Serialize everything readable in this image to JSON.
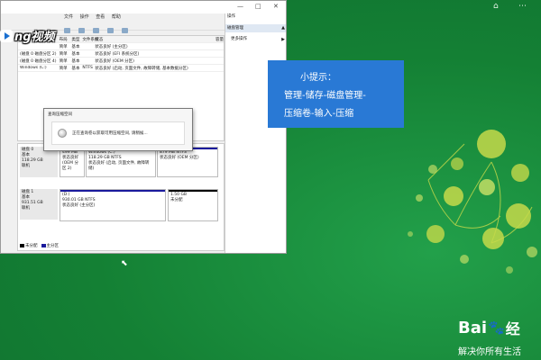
{
  "video_logo": {
    "text": "ng视频"
  },
  "window": {
    "controls": {
      "minimize": "—",
      "maximize": "□",
      "close": "✕"
    },
    "menu": [
      "文件",
      "操作",
      "查看",
      "帮助"
    ],
    "volume_table": {
      "headers": {
        "name": "卷",
        "layout": "布局",
        "type": "类型",
        "fs": "文件系统",
        "status": "状态",
        "capacity": "容量"
      },
      "rows": [
        {
          "name": "",
          "layout": "简单",
          "type": "基本",
          "fs": "",
          "status": "状态良好 (主分区)",
          "capacity": ""
        },
        {
          "name": "(磁盘 0 磁盘分区 2)",
          "layout": "简单",
          "type": "基本",
          "fs": "",
          "status": "状态良好 (EFI 系统分区)",
          "capacity": ""
        },
        {
          "name": "(磁盘 0 磁盘分区 4)",
          "layout": "简单",
          "type": "基本",
          "fs": "",
          "status": "状态良好 (OEM 分区)",
          "capacity": ""
        },
        {
          "name": "Windows (C:)",
          "layout": "简单",
          "type": "基本",
          "fs": "NTFS",
          "status": "状态良好 (启动, 页面文件, 故障转储, 基本数据分区)",
          "capacity": ""
        }
      ]
    },
    "disks": [
      {
        "label": "磁盘 0",
        "type": "基本",
        "size": "118.29 GB",
        "status": "联机",
        "partitions": [
          {
            "title": "",
            "size": "499 MB",
            "status": "状态良好 (OEM 分区 2)"
          },
          {
            "title": "Windows (C:)",
            "size": "118.29 GB NTFS",
            "status": "状态良好 (启动, 页面文件, 故障转储)"
          },
          {
            "title": "",
            "size": "879 MB NTFS",
            "status": "状态良好 (OEM 分区)"
          }
        ]
      },
      {
        "label": "磁盘 1",
        "type": "基本",
        "size": "931.51 GB",
        "status": "联机",
        "partitions": [
          {
            "title": "(D:)",
            "size": "930.01 GB NTFS",
            "status": "状态良好 (主分区)"
          },
          {
            "title": "",
            "size": "1.50 GB",
            "status": "未分配"
          }
        ]
      }
    ],
    "legend": [
      {
        "label": "未分配",
        "color": "#000000"
      },
      {
        "label": "主分区",
        "color": "#1a1a9c"
      }
    ],
    "actions": {
      "title": "操作",
      "section": "磁盘管理",
      "item": "更多操作"
    }
  },
  "dialog": {
    "title": "查询压缩空间",
    "message": "正在查询卷以获取可用压缩空间, 请稍候..."
  },
  "tip": {
    "title": "小提示：",
    "line1": "管理-储存-磁盘管理-",
    "line2": "压缩卷-输入-压缩"
  },
  "top_controls": {
    "icon1": "⌂",
    "icon2": "⋯"
  },
  "brand": {
    "name_a": "Bai",
    "paw": "🐾",
    "name_b": "经",
    "slogan": "解决你所有生活"
  },
  "colors": {
    "accent_green": "#1a8a3c",
    "tip_blue": "#2979d5",
    "partition_primary": "#1a1a9c",
    "partition_unallocated": "#000000"
  }
}
